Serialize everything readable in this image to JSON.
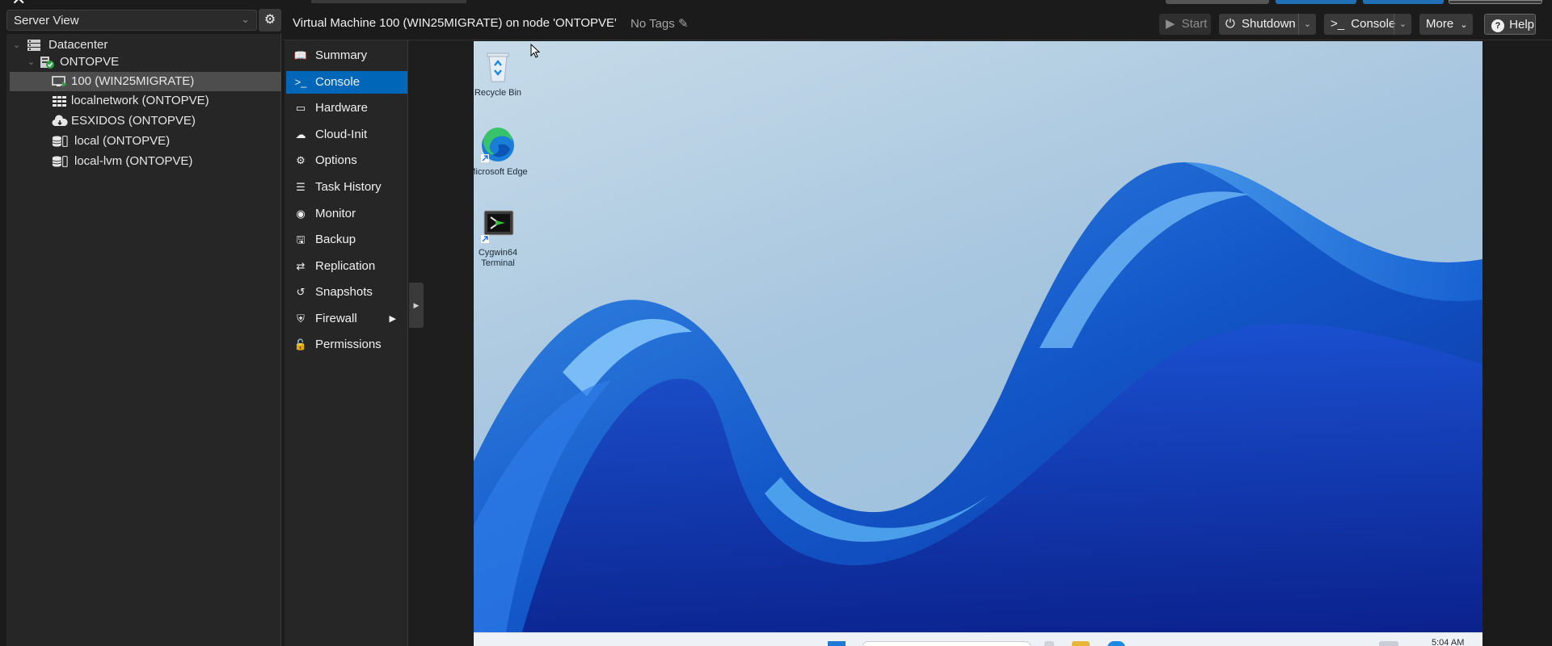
{
  "tree": {
    "view_select": "Server View",
    "items": [
      {
        "label": "Datacenter",
        "icon": "datacenter-icon"
      },
      {
        "label": "ONTOPVE",
        "icon": "node-online-icon"
      },
      {
        "label": "100 (WIN25MIGRATE)",
        "icon": "vm-running-icon"
      },
      {
        "label": "localnetwork (ONTOPVE)",
        "icon": "network-grid-icon"
      },
      {
        "label": "ESXIDOS (ONTOPVE)",
        "icon": "cloud-storage-icon"
      },
      {
        "label": "local (ONTOPVE)",
        "icon": "storage-icon"
      },
      {
        "label": "local-lvm (ONTOPVE)",
        "icon": "storage-icon"
      }
    ]
  },
  "header": {
    "title": "Virtual Machine 100 (WIN25MIGRATE) on node 'ONTOPVE'",
    "tags": "No Tags",
    "buttons": {
      "start": "Start",
      "shutdown": "Shutdown",
      "console": "Console",
      "more": "More",
      "help": "Help"
    }
  },
  "nav": {
    "items": [
      {
        "label": "Summary",
        "icon": "book-icon"
      },
      {
        "label": "Console",
        "icon": "terminal-icon"
      },
      {
        "label": "Hardware",
        "icon": "monitor-icon"
      },
      {
        "label": "Cloud-Init",
        "icon": "cloud-icon"
      },
      {
        "label": "Options",
        "icon": "gear-icon"
      },
      {
        "label": "Task History",
        "icon": "list-icon"
      },
      {
        "label": "Monitor",
        "icon": "eye-icon"
      },
      {
        "label": "Backup",
        "icon": "floppy-icon"
      },
      {
        "label": "Replication",
        "icon": "retweet-icon"
      },
      {
        "label": "Snapshots",
        "icon": "history-icon"
      },
      {
        "label": "Firewall",
        "icon": "shield-icon"
      },
      {
        "label": "Permissions",
        "icon": "unlock-icon"
      }
    ],
    "selected": "Console"
  },
  "desktop": {
    "icons": [
      {
        "label": "Recycle Bin",
        "icon": "recycle-bin-icon"
      },
      {
        "label": "Microsoft Edge",
        "icon": "edge-icon"
      },
      {
        "label": "Cygwin64 Terminal",
        "icon": "cygwin-terminal-icon"
      }
    ],
    "clock": "5:04 AM"
  },
  "colors": {
    "accent": "#0066b8",
    "panel": "#262626",
    "background": "#1b1b1b"
  }
}
